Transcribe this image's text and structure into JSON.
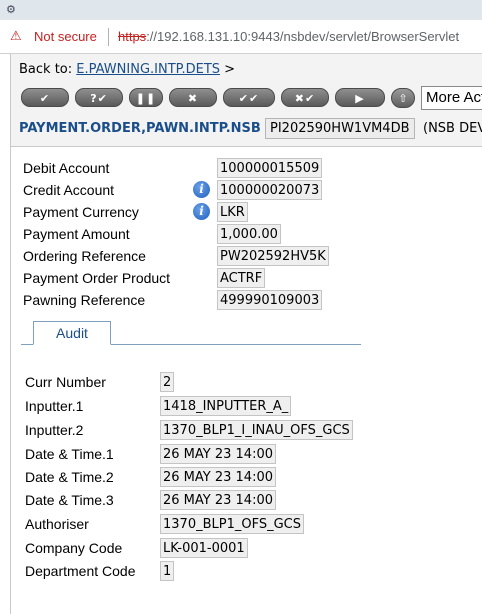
{
  "browser": {
    "security_label": "Not secure",
    "url_scheme": "https",
    "url_rest": "://192.168.131.10:9443/nsbdev/servlet/BrowserServlet"
  },
  "header": {
    "back_prefix": "Back to:",
    "back_link": "E.PAWNING.INTP.DETS",
    "back_suffix": ">",
    "app_name": "PAYMENT.ORDER,PAWN.INTP.NSB",
    "txn_id": "PI202590HW1VM4DB",
    "env_label": "(NSB DEV"
  },
  "toolbar": {
    "buttons": [
      {
        "name": "commit-button",
        "glyph": "✔"
      },
      {
        "name": "validate-button",
        "glyph": "?✔"
      },
      {
        "name": "hold-button",
        "glyph": "❚❚"
      },
      {
        "name": "delete-button",
        "glyph": "✖"
      },
      {
        "name": "authorise-button",
        "glyph": "✔✔"
      },
      {
        "name": "reverse-button",
        "glyph": "✖✔"
      },
      {
        "name": "next-button",
        "glyph": "▶"
      }
    ],
    "more_actions": "More Actions"
  },
  "fields": [
    {
      "label": "Debit Account",
      "value": "100000015509",
      "info": false
    },
    {
      "label": "Credit Account",
      "value": "100000020073",
      "info": true
    },
    {
      "label": "Payment Currency",
      "value": "LKR",
      "info": true
    },
    {
      "label": "Payment Amount",
      "value": "1,000.00",
      "info": false
    },
    {
      "label": "Ordering Reference",
      "value": "PW202592HV5K",
      "info": false
    },
    {
      "label": "Payment Order Product",
      "value": "ACTRF",
      "info": false
    },
    {
      "label": "Pawning Reference",
      "value": "499990109003",
      "info": false
    }
  ],
  "tabs": [
    {
      "label": "Audit"
    }
  ],
  "audit": [
    {
      "label": "Curr Number",
      "value": "2"
    },
    {
      "label": "Inputter.1",
      "value": "1418_INPUTTER_A_"
    },
    {
      "label": "Inputter.2",
      "value": "1370_BLP1_I_INAU_OFS_GCS"
    },
    {
      "label": "Date & Time.1",
      "value": "26 MAY 23 14:00"
    },
    {
      "label": "Date & Time.2",
      "value": "26 MAY 23 14:00"
    },
    {
      "label": "Date & Time.3",
      "value": "26 MAY 23 14:00"
    },
    {
      "label": "Authoriser",
      "value": "1370_BLP1_OFS_GCS"
    },
    {
      "label": "Company Code",
      "value": "LK-001-0001"
    },
    {
      "label": "Department Code",
      "value": "1"
    }
  ]
}
